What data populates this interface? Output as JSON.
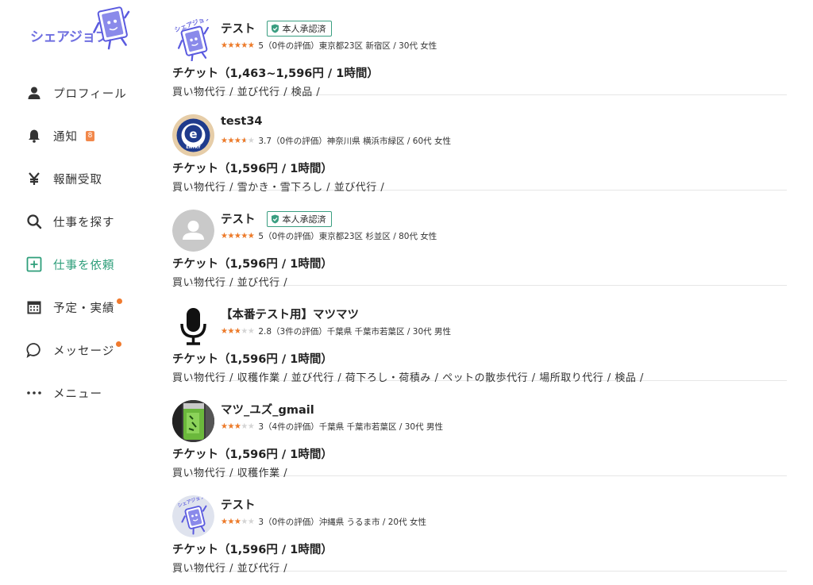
{
  "brand": {
    "name": "シェアジョブ",
    "mascot_text": "シェアジョブ",
    "accent": "#6f6fe0"
  },
  "sidebar": {
    "items": [
      {
        "label": "プロフィール",
        "icon": "person-icon"
      },
      {
        "label": "通知",
        "icon": "bell-icon",
        "badge": "8"
      },
      {
        "label": "報酬受取",
        "icon": "yen-icon"
      },
      {
        "label": "仕事を探す",
        "icon": "search-icon"
      },
      {
        "label": "仕事を依頼",
        "icon": "plus-square-icon",
        "active": true
      },
      {
        "label": "予定・実績",
        "icon": "calendar-icon",
        "dot": true
      },
      {
        "label": "メッセージ",
        "icon": "chat-bubble-icon",
        "dot": true
      },
      {
        "label": "メニュー",
        "icon": "more-dots-icon"
      }
    ]
  },
  "workers": [
    {
      "name": "テスト",
      "verified": "本人承認済",
      "rating": 5,
      "rating_text": "5",
      "meta": "（0件の評価）東京都23区 新宿区 / 30代 女性",
      "ticket": "チケット（1,463~1,596円 / 1時間）",
      "categories": "買い物代行 / 並び代行 / 検品 /",
      "avatar": "mascot"
    },
    {
      "name": "test34",
      "verified": "",
      "rating": 3.7,
      "rating_text": "3.7",
      "meta": "（0件の評価）神奈川県 横浜市緑区 / 60代 女性",
      "ticket": "チケット（1,596円 / 1時間）",
      "categories": "買い物代行 / 雪かき・雪下ろし / 並び代行 /",
      "avatar": "entry-badge",
      "avatar_text": "ENTRY"
    },
    {
      "name": "テスト",
      "verified": "本人承認済",
      "rating": 5,
      "rating_text": "5",
      "meta": "（0件の評価）東京都23区 杉並区 / 80代 女性",
      "ticket": "チケット（1,596円 / 1時間）",
      "categories": "買い物代行 / 並び代行 /",
      "avatar": "default"
    },
    {
      "name": "【本番テスト用】マツマツ",
      "verified": "",
      "rating": 2.8,
      "rating_text": "2.8",
      "meta": "（3件の評価）千葉県 千葉市若葉区 / 30代 男性",
      "ticket": "チケット（1,596円 / 1時間）",
      "categories": "買い物代行 / 収穫作業 / 並び代行 / 荷下ろし・荷積み / ペットの散歩代行 / 場所取り代行 / 検品 /",
      "avatar": "microphone"
    },
    {
      "name": "マツ_ユズ_gmail",
      "verified": "",
      "rating": 3,
      "rating_text": "3",
      "meta": "（4件の評価）千葉県 千葉市若葉区 / 30代 男性",
      "ticket": "チケット（1,596円 / 1時間）",
      "categories": "買い物代行 / 収穫作業 /",
      "avatar": "photo-tea-can"
    },
    {
      "name": "テスト",
      "verified": "",
      "rating": 3,
      "rating_text": "3",
      "meta": "（0件の評価）沖縄県 うるま市 / 20代 女性",
      "ticket": "チケット（1,596円 / 1時間）",
      "categories": "買い物代行 / 並び代行 /",
      "avatar": "mascot-circle"
    }
  ],
  "colors": {
    "star": "#ee7a28",
    "star_empty": "#d4d4d4",
    "verified_border": "#3a9e81",
    "active_nav": "#2e9e7a",
    "badge": "#f2884b",
    "dot": "#f07a2e"
  }
}
